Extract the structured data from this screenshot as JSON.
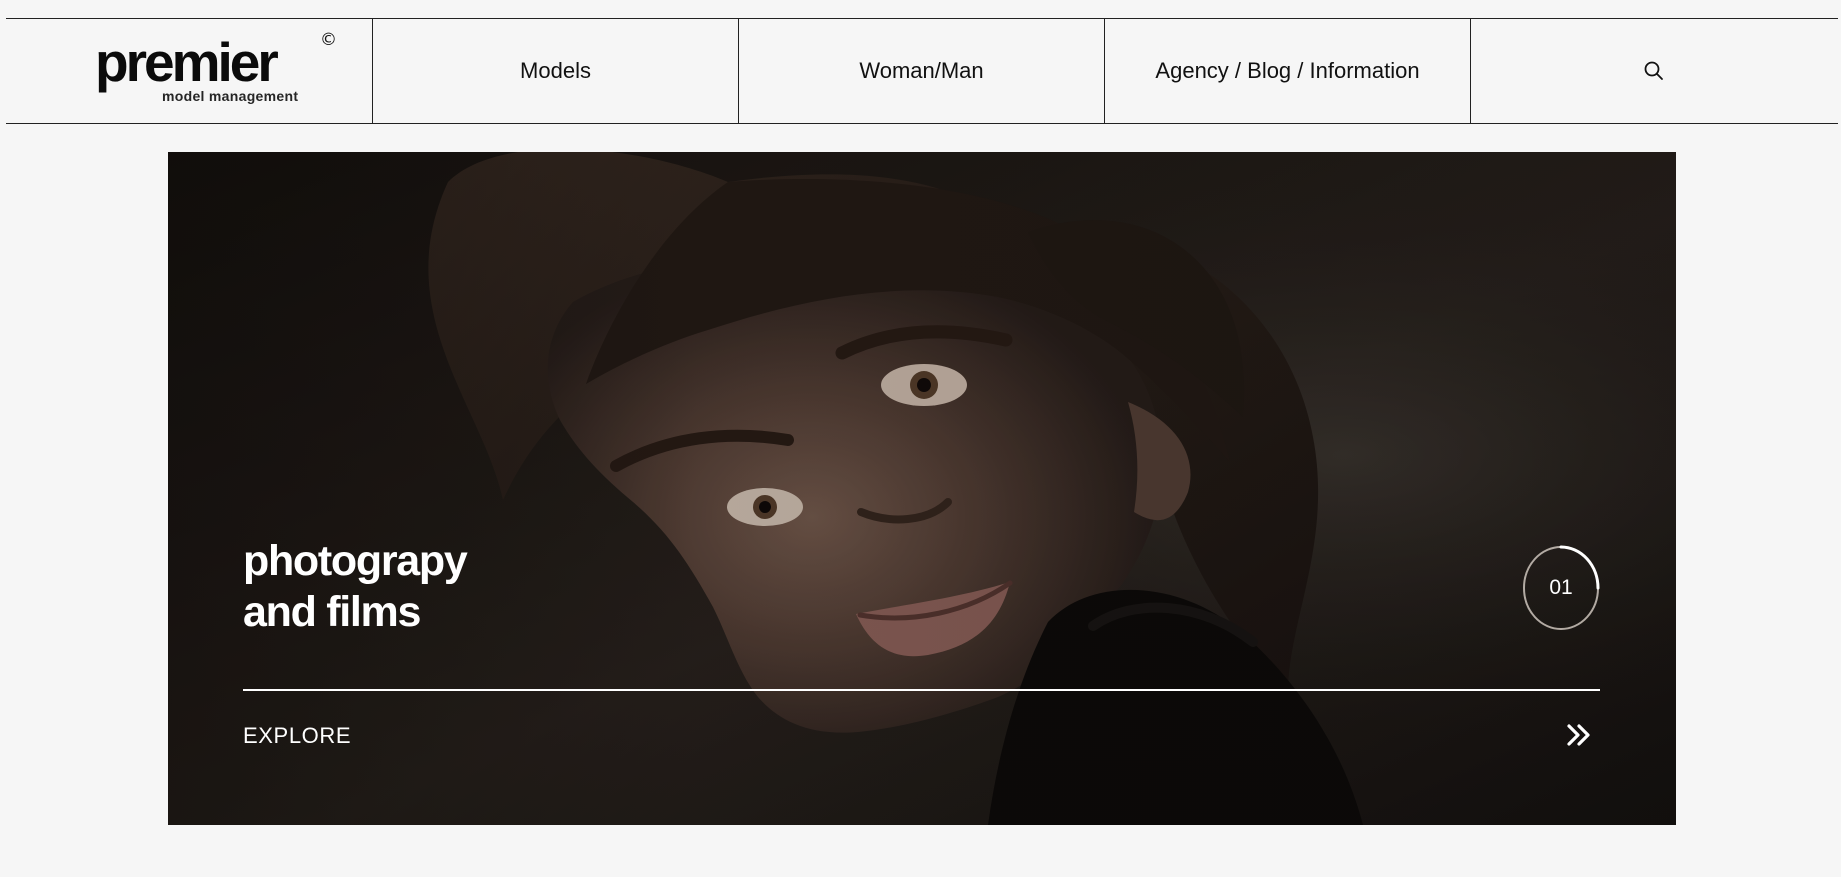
{
  "header": {
    "logo": {
      "wordmark": "premier",
      "subtitle": "model management",
      "mark": "©"
    },
    "nav_items": [
      {
        "label": "Models"
      },
      {
        "label": "Woman/Man"
      },
      {
        "label": "Agency / Blog / Information"
      }
    ],
    "search_icon": "search-icon"
  },
  "hero": {
    "title_line_1": "photograpy",
    "title_line_2": "and films",
    "slide_number": "01",
    "slide_progress": 0.25,
    "cta_label": "EXPLORE",
    "cta_icon": "double-chevron-right-icon",
    "image_description_icon": "portrait-photo"
  },
  "colors": {
    "background": "#f6f6f6",
    "header_border": "#222222",
    "hero_overlay": "#1c1714",
    "hero_text": "#ffffff"
  }
}
